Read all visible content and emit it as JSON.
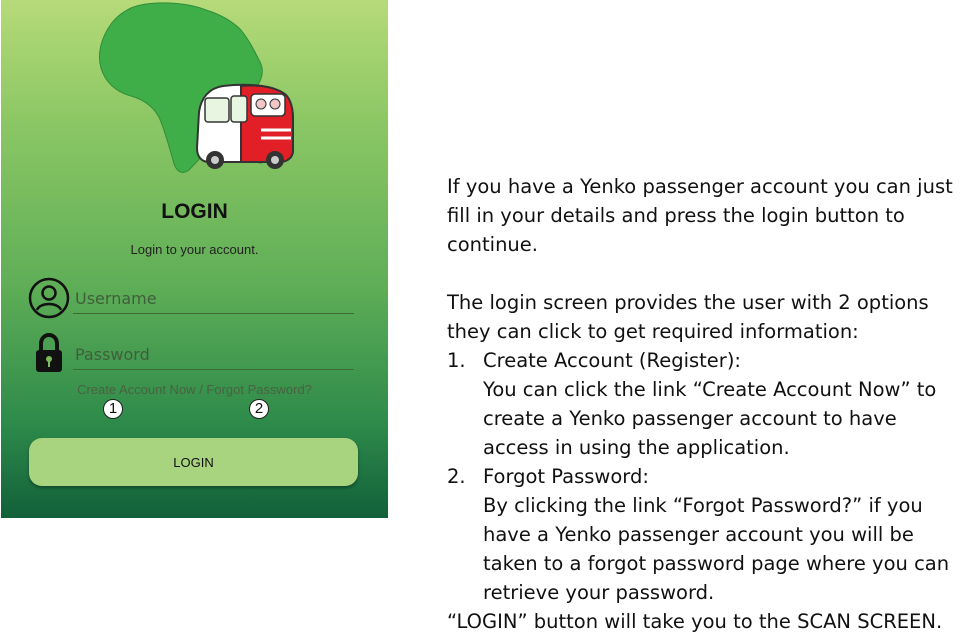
{
  "screen": {
    "title": "LOGIN",
    "subtitle": "Login to your account.",
    "username_placeholder": "Username",
    "password_placeholder": "Password",
    "create_account_link": "Create Account Now",
    "link_separator": " / ",
    "forgot_password_link": "Forgot Password?",
    "marker_1": "1",
    "marker_2": "2",
    "login_button": "LOGIN",
    "colors": {
      "gradient_top": "#b6da79",
      "gradient_bottom": "#12603a",
      "button": "#a9d47f",
      "van_red": "#e21f26",
      "africa_green": "#3fae49"
    },
    "icons": [
      "africa-van-logo",
      "user-icon",
      "lock-icon"
    ]
  },
  "description": {
    "intro": "If you have a Yenko passenger account you can just fill in your details and press the login button to continue.",
    "options_intro": "The login screen provides the user with 2 options they can click to get required information:",
    "items": [
      {
        "number": "1.",
        "title": "Create Account (Register):",
        "body": "You can click the link “Create Account Now” to create a Yenko passenger account to have access in using the application."
      },
      {
        "number": "2.",
        "title": "Forgot Password:",
        "body": "By clicking the link “Forgot Password?” if you have a Yenko passenger account you will be taken to a forgot password page where you can retrieve your password."
      }
    ],
    "footer": "“LOGIN” button will take you to the SCAN SCREEN."
  }
}
